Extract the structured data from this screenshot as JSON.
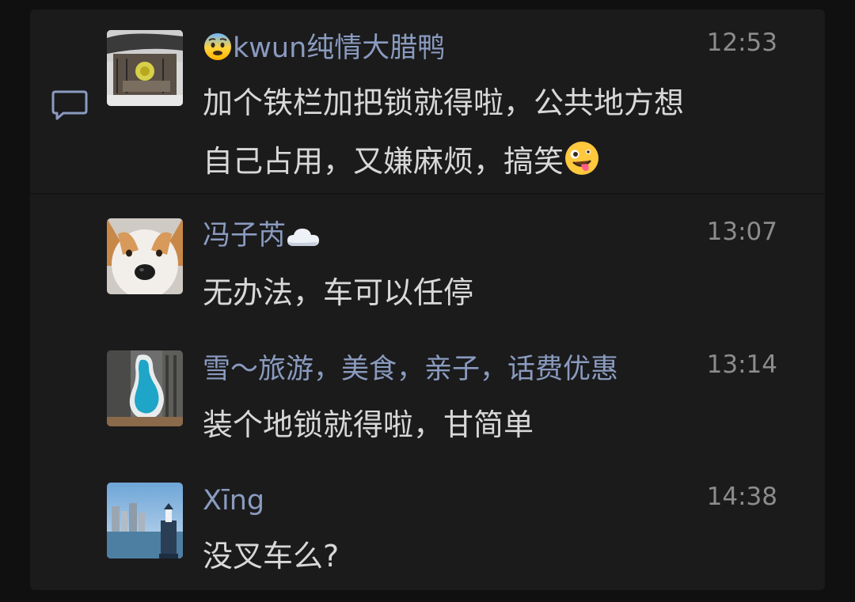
{
  "comments": [
    {
      "name": "kwun纯情大腊鸭",
      "name_emoji": "fearful-face-emoji",
      "time": "12:53",
      "text_line1": "加个铁栏加把锁就得啦，公共地方想",
      "text_line2": "自己占用，又嫌麻烦，搞笑",
      "text_emoji": "zany-face-emoji"
    },
    {
      "name": "冯子芮",
      "name_emoji": "cloud-emoji",
      "time": "13:07",
      "text": "无办法，车可以任停"
    },
    {
      "name": "雪～旅游，美食，亲子，话费优惠",
      "time": "13:14",
      "text": "装个地锁就得啦，甘简单"
    },
    {
      "name": "Xīng",
      "time": "14:38",
      "text": "没叉车么?"
    }
  ],
  "icons": {
    "comment": "comment-bubble-icon"
  },
  "colors": {
    "background": "#101010",
    "card": "#1b1b1c",
    "name": "#8a9bbf",
    "text": "#d8d8d8",
    "time": "#8c8c8c"
  }
}
